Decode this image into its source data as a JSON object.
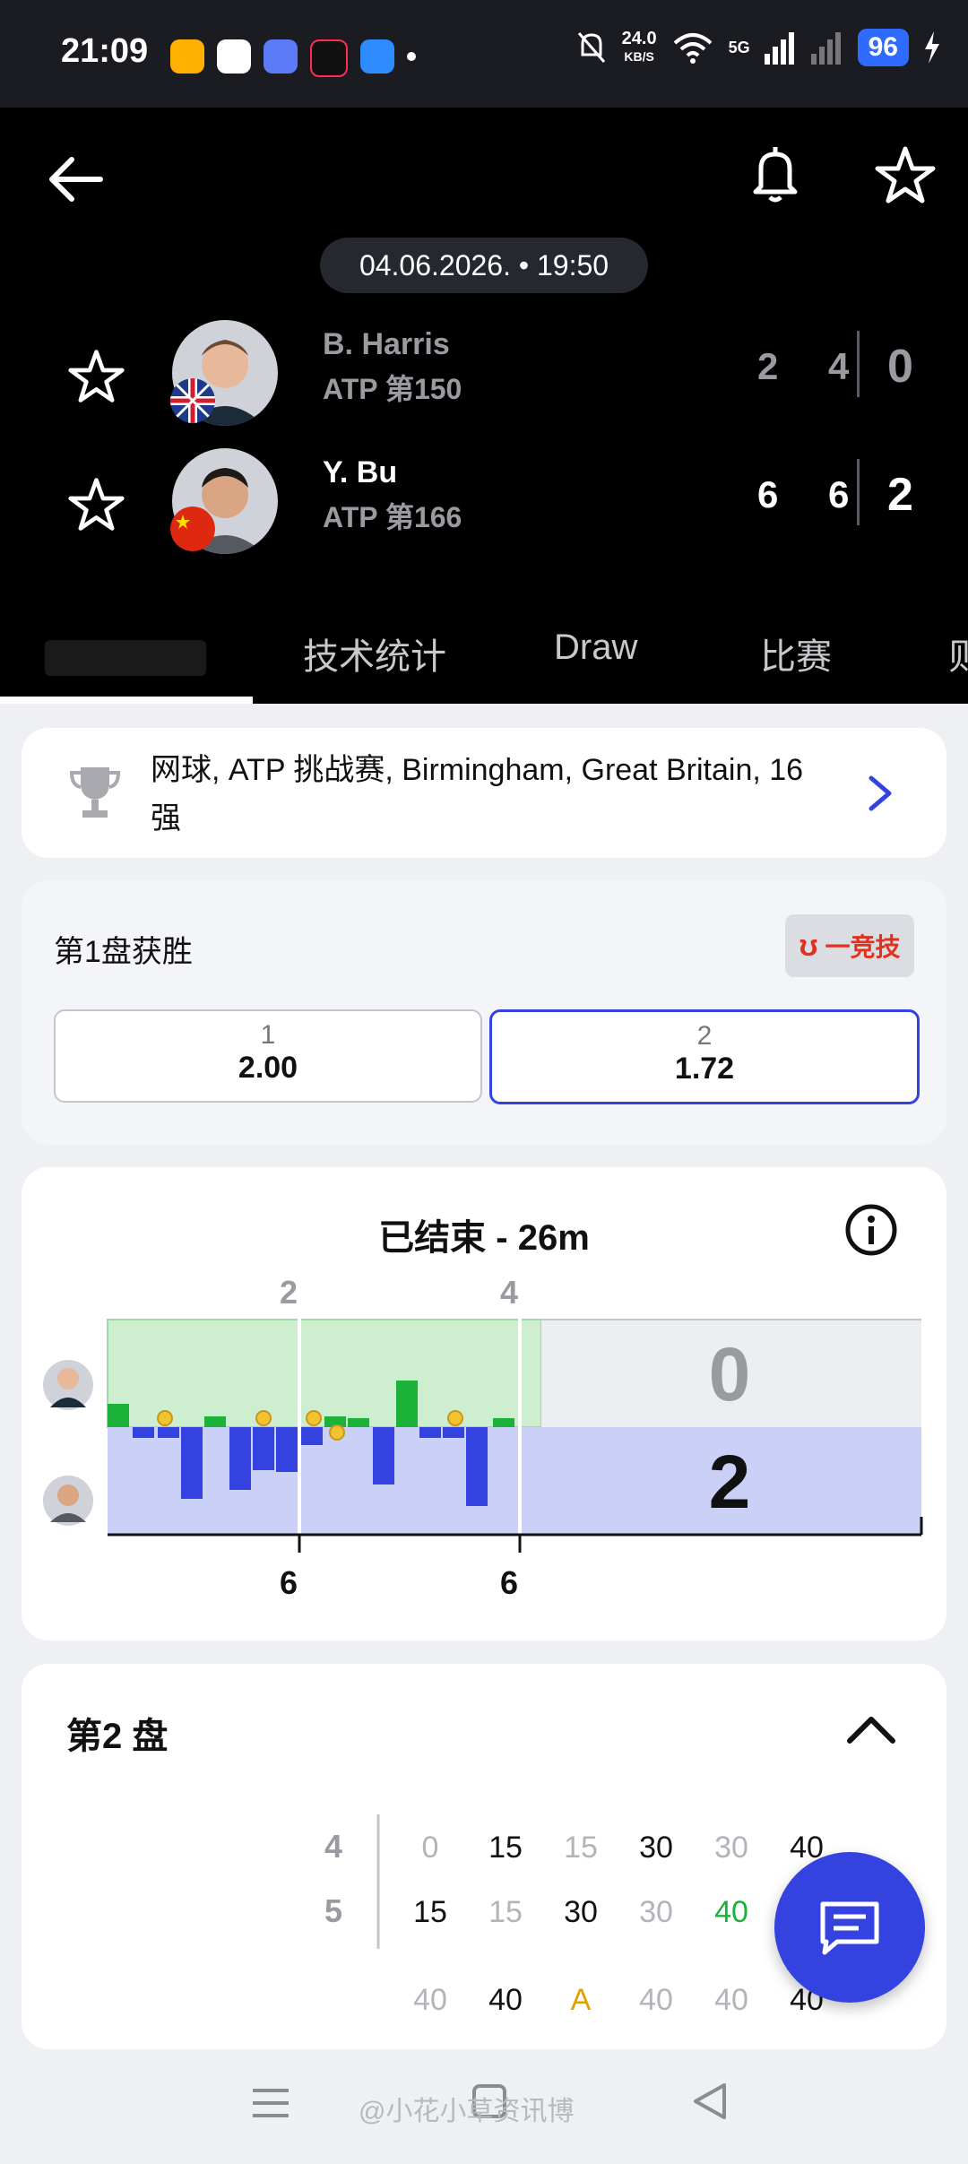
{
  "status": {
    "time": "21:09",
    "speed_value": "24.0",
    "speed_unit": "KB/S",
    "network": "5G",
    "battery": "96"
  },
  "match": {
    "date": "04.06.2026. • 19:50",
    "players": [
      {
        "name": "B. Harris",
        "rank": "ATP 第150",
        "games": "2 4",
        "sets": "0"
      },
      {
        "name": "Y. Bu",
        "rank": "ATP 第166",
        "games": "6 6",
        "sets": "2"
      }
    ]
  },
  "tabs": [
    "技术统计",
    "Draw",
    "比赛",
    "则"
  ],
  "competition": {
    "text": "网球, ATP 挑战赛, Birmingham, Great Britain, 16强"
  },
  "odds": {
    "title": "第1盘获胜",
    "brand": "一竞技",
    "options": [
      {
        "label": "1",
        "value": "2.00"
      },
      {
        "label": "2",
        "value": "1.72"
      }
    ]
  },
  "momentum": {
    "title": "已结束 - 26m",
    "top_set_labels": [
      "2",
      "4"
    ],
    "bottom_set_labels": [
      "6",
      "6"
    ],
    "score_top": "0",
    "score_bottom": "2"
  },
  "set2": {
    "title": "第2 盘",
    "rows": [
      {
        "game": "4",
        "points": [
          "0",
          "15",
          "15",
          "30",
          "30",
          "40"
        ]
      },
      {
        "game": "5",
        "points": [
          "15",
          "15",
          "30",
          "30",
          "40"
        ]
      }
    ],
    "next_row": [
      "40",
      "40",
      "A",
      "40",
      "40",
      "40"
    ]
  },
  "watermark": "@小花小草资讯博",
  "colors": {
    "accent": "#3442e0",
    "top_player_zone": "#cdeecf",
    "bottom_player_zone": "#cbd0f7",
    "bar_green": "#1cb23a",
    "bar_blue": "#3442e0"
  }
}
